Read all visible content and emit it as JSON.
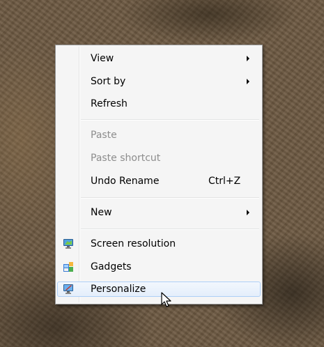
{
  "context_menu": {
    "items": [
      {
        "label": "View",
        "has_submenu": true
      },
      {
        "label": "Sort by",
        "has_submenu": true
      },
      {
        "label": "Refresh"
      },
      {
        "label": "Paste",
        "disabled": true
      },
      {
        "label": "Paste shortcut",
        "disabled": true
      },
      {
        "label": "Undo Rename",
        "shortcut": "Ctrl+Z"
      },
      {
        "label": "New",
        "has_submenu": true
      },
      {
        "label": "Screen resolution",
        "icon": "monitor-icon"
      },
      {
        "label": "Gadgets",
        "icon": "gadgets-icon"
      },
      {
        "label": "Personalize",
        "icon": "personalize-icon",
        "highlighted": true
      }
    ]
  },
  "colors": {
    "menu_background": "#f5f5f5",
    "menu_border": "#979797",
    "disabled_text": "#8d8d8d",
    "highlight_border": "#aecff7"
  }
}
